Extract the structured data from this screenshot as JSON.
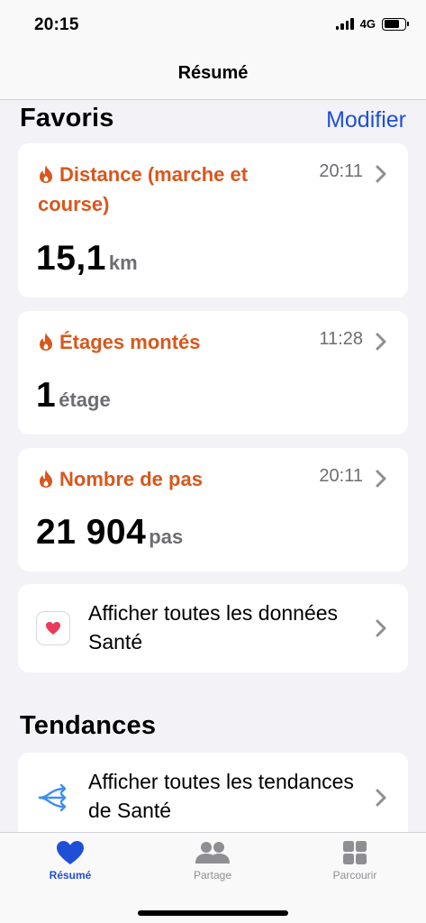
{
  "status_bar": {
    "time": "20:15",
    "network": "4G"
  },
  "nav": {
    "title": "Résumé"
  },
  "favorites": {
    "header": "Favoris",
    "edit_label": "Modifier",
    "cards": [
      {
        "title": "Distance (marche et course)",
        "time": "20:11",
        "value": "15,1",
        "unit": "km"
      },
      {
        "title": "Étages montés",
        "time": "11:28",
        "value": "1",
        "unit": "étage"
      },
      {
        "title": "Nombre de pas",
        "time": "20:11",
        "value": "21 904",
        "unit": "pas"
      }
    ],
    "show_all_label": "Afficher toutes les données Santé"
  },
  "trends": {
    "header": "Tendances",
    "show_all_label": "Afficher toutes les tendances de Santé"
  },
  "tabs": [
    {
      "label": "Résumé",
      "icon": "heart-icon",
      "active": true
    },
    {
      "label": "Partage",
      "icon": "people-icon",
      "active": false
    },
    {
      "label": "Parcourir",
      "icon": "grid-icon",
      "active": false
    }
  ],
  "colors": {
    "accent": "#1f4fd7",
    "metric_orange": "#d8571c",
    "health_pink": "#ec3a5a"
  }
}
